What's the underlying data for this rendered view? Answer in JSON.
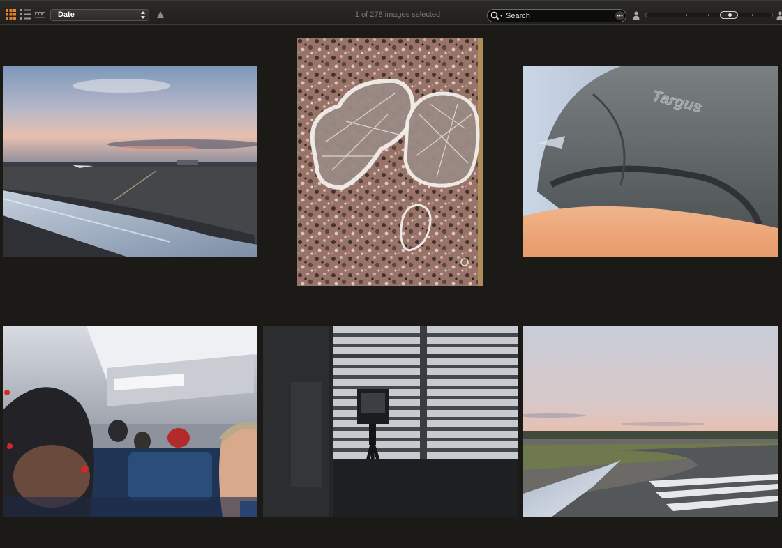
{
  "toolbar": {
    "view_modes": [
      {
        "name": "grid-view",
        "selected": true
      },
      {
        "name": "list-view",
        "selected": false
      },
      {
        "name": "filmstrip-view",
        "selected": false
      }
    ],
    "sort": {
      "selected": "Date"
    },
    "sort_direction": "ascending",
    "status": "1 of 278 images selected",
    "search": {
      "placeholder": "Search"
    },
    "accent_color": "#e8822a"
  },
  "thumbnails": [
    {
      "name": "photo-sunset-airport-wing",
      "selected": false
    },
    {
      "name": "photo-granite-frost-pattern",
      "selected": false
    },
    {
      "name": "photo-backpack-closeup",
      "selected": false
    },
    {
      "name": "photo-airplane-cabin",
      "selected": false
    },
    {
      "name": "photo-camera-by-window",
      "selected": false
    },
    {
      "name": "photo-runway-wing-dusk",
      "selected": false
    }
  ]
}
